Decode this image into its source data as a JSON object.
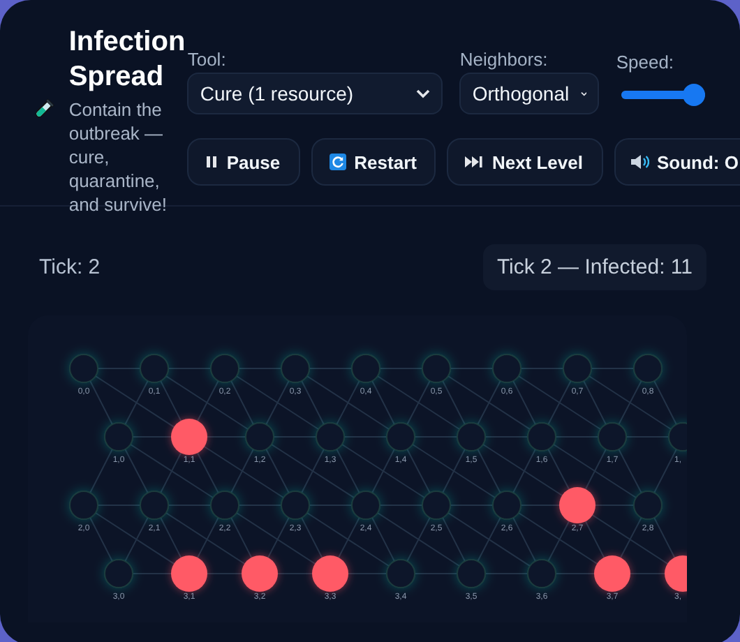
{
  "app": {
    "title": "Infection Spread",
    "subtitle": "Contain the outbreak — cure, quarantine, and survive!"
  },
  "controls": {
    "tool": {
      "label": "Tool:",
      "value": "Cure (1 resource)"
    },
    "neighbors": {
      "label": "Neighbors:",
      "value": "Orthogonal"
    },
    "speed": {
      "label": "Speed:",
      "level": 1
    }
  },
  "buttons": [
    {
      "kind": "pause",
      "label": "Pause"
    },
    {
      "kind": "restart",
      "label": "Restart"
    },
    {
      "kind": "next",
      "label": "Next Level"
    },
    {
      "kind": "sound",
      "label": "Sound: O"
    }
  ],
  "status": {
    "tick": "Tick: 2",
    "summary": "Tick 2 — Infected: 11"
  },
  "grid": {
    "rows": [
      [
        {
          "label": "0,0",
          "infected": false
        },
        {
          "label": "0,1",
          "infected": false
        },
        {
          "label": "0,2",
          "infected": false
        },
        {
          "label": "0,3",
          "infected": false
        },
        {
          "label": "0,4",
          "infected": false
        },
        {
          "label": "0,5",
          "infected": false
        },
        {
          "label": "0,6",
          "infected": false
        },
        {
          "label": "0,7",
          "infected": false
        },
        {
          "label": "0,8",
          "infected": false
        }
      ],
      [
        {
          "label": "1,0",
          "infected": false
        },
        {
          "label": "1,1",
          "infected": true
        },
        {
          "label": "1,2",
          "infected": false
        },
        {
          "label": "1,3",
          "infected": false
        },
        {
          "label": "1,4",
          "infected": false
        },
        {
          "label": "1,5",
          "infected": false
        },
        {
          "label": "1,6",
          "infected": false
        },
        {
          "label": "1,7",
          "infected": false
        },
        {
          "label": "1,",
          "infected": false
        }
      ],
      [
        {
          "label": "2,0",
          "infected": false
        },
        {
          "label": "2,1",
          "infected": false
        },
        {
          "label": "2,2",
          "infected": false
        },
        {
          "label": "2,3",
          "infected": false
        },
        {
          "label": "2,4",
          "infected": false
        },
        {
          "label": "2,5",
          "infected": false
        },
        {
          "label": "2,6",
          "infected": false
        },
        {
          "label": "2,7",
          "infected": true
        },
        {
          "label": "2,8",
          "infected": false
        }
      ],
      [
        {
          "label": "3,0",
          "infected": false
        },
        {
          "label": "3,1",
          "infected": true
        },
        {
          "label": "3,2",
          "infected": true
        },
        {
          "label": "3,3",
          "infected": true
        },
        {
          "label": "3,4",
          "infected": false
        },
        {
          "label": "3,5",
          "infected": false
        },
        {
          "label": "3,6",
          "infected": false
        },
        {
          "label": "3,7",
          "infected": true
        },
        {
          "label": "3,",
          "infected": true
        }
      ]
    ]
  }
}
